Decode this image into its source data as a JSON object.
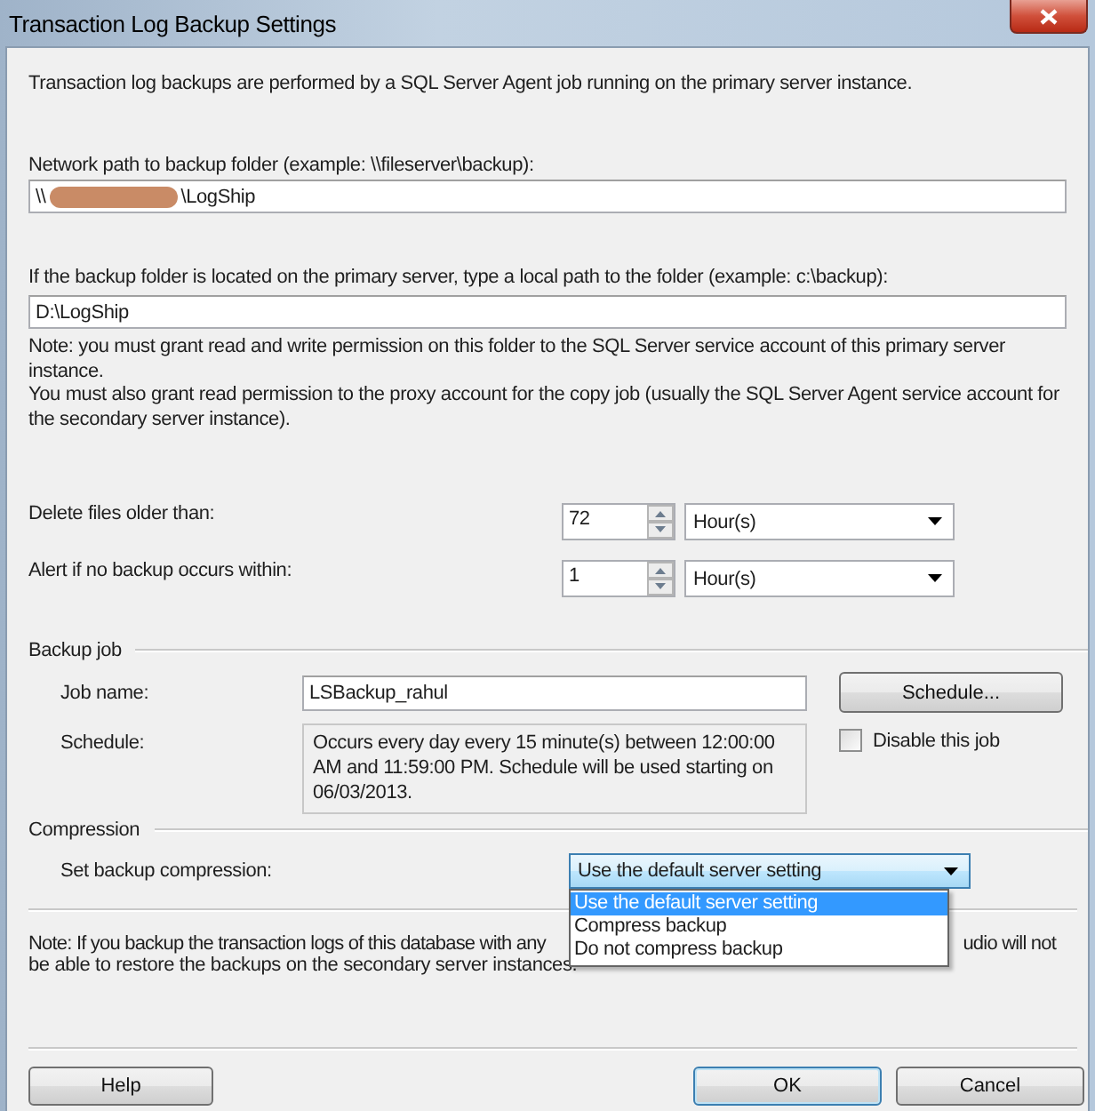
{
  "window": {
    "title": "Transaction Log Backup Settings"
  },
  "intro": "Transaction log backups are performed by a SQL Server Agent job running on the primary server instance.",
  "network_path": {
    "label": "Network path to backup folder (example: \\\\fileserver\\backup):",
    "value_start": "\\\\",
    "value_end": "\\LogShip"
  },
  "local_path": {
    "label": "If the backup folder is located on the primary server, type a local path to the folder (example: c:\\backup):",
    "value": "D:\\LogShip"
  },
  "permission_note": "Note: you must grant read and write permission on this folder to the SQL Server service account of this primary server instance.\n You must also grant read permission to the proxy account for the copy job (usually the SQL Server Agent service account for the secondary server instance).",
  "retention": [
    {
      "label": "Delete files older than:",
      "value": "72",
      "unit": "Hour(s)"
    },
    {
      "label": "Alert if no backup occurs within:",
      "value": "1",
      "unit": "Hour(s)"
    }
  ],
  "backup_job": {
    "title": "Backup job",
    "job_name_label": "Job name:",
    "job_name": "LSBackup_rahul",
    "schedule_button": "Schedule...",
    "schedule_label": "Schedule:",
    "schedule": "Occurs every day every 15 minute(s) between 12:00:00 AM and 11:59:00 PM. Schedule will be used starting on 06/03/2013.",
    "disable": {
      "label": "Disable this job",
      "checked": false
    }
  },
  "compression": {
    "title": "Compression",
    "label": "Set backup compression:",
    "value": "Use the default server setting",
    "expanded": true,
    "options": [
      {
        "label": "Use the default server setting",
        "selected": true
      },
      {
        "label": "Compress backup",
        "selected": false
      },
      {
        "label": "Do not compress backup",
        "selected": false
      }
    ]
  },
  "compression_note": {
    "line_1_start": "Note: If you backup the transaction logs of this database with any",
    "line_1_end": "udio will not",
    "line_2": "be able to restore the backups on the secondary server instances."
  },
  "buttons": {
    "help": "Help",
    "ok": "OK",
    "cancel": "Cancel"
  }
}
